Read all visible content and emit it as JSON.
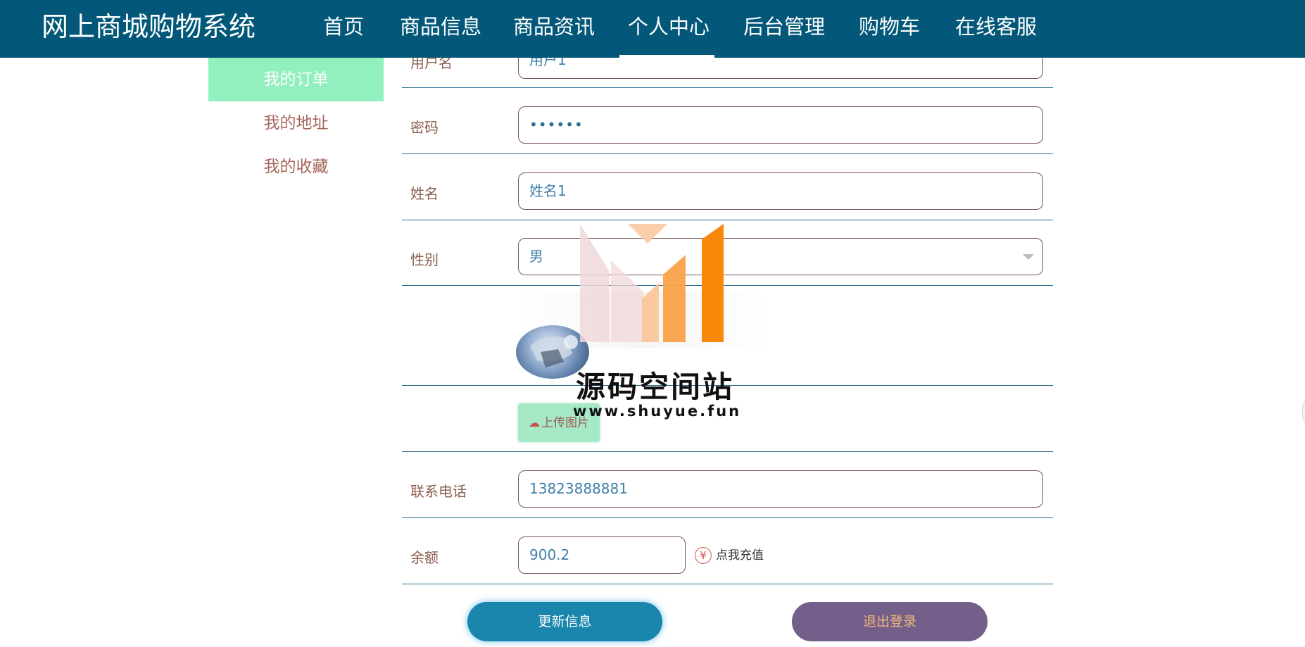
{
  "header": {
    "brand": "网上商城购物系统",
    "nav": [
      {
        "label": "首页",
        "active": false
      },
      {
        "label": "商品信息",
        "active": false
      },
      {
        "label": "商品资讯",
        "active": false
      },
      {
        "label": "个人中心",
        "active": true
      },
      {
        "label": "后台管理",
        "active": false
      },
      {
        "label": "购物车",
        "active": false
      },
      {
        "label": "在线客服",
        "active": false
      }
    ]
  },
  "sidebar": {
    "items": [
      {
        "label": "我的订单",
        "active": true
      },
      {
        "label": "我的地址",
        "active": false
      },
      {
        "label": "我的收藏",
        "active": false
      }
    ]
  },
  "form": {
    "username": {
      "label": "用户名",
      "value": "用户1"
    },
    "password": {
      "label": "密码",
      "value": "••••••"
    },
    "name": {
      "label": "姓名",
      "value": "姓名1"
    },
    "gender": {
      "label": "性别",
      "value": "男"
    },
    "upload_label": "上传图片",
    "phone": {
      "label": "联系电话",
      "value": "13823888881"
    },
    "balance": {
      "label": "余额",
      "value": "900.2"
    },
    "recharge_label": "点我充值",
    "recharge_icon": "¥",
    "update_button": "更新信息",
    "logout_button": "退出登录"
  },
  "watermark": {
    "text": "源码空间站",
    "url": "www.shuyue.fun"
  },
  "colors": {
    "topbar": "#035879",
    "sidebar_active": "#92efbe",
    "update_button": "#1a85ad",
    "logout_button": "#745f8a"
  }
}
